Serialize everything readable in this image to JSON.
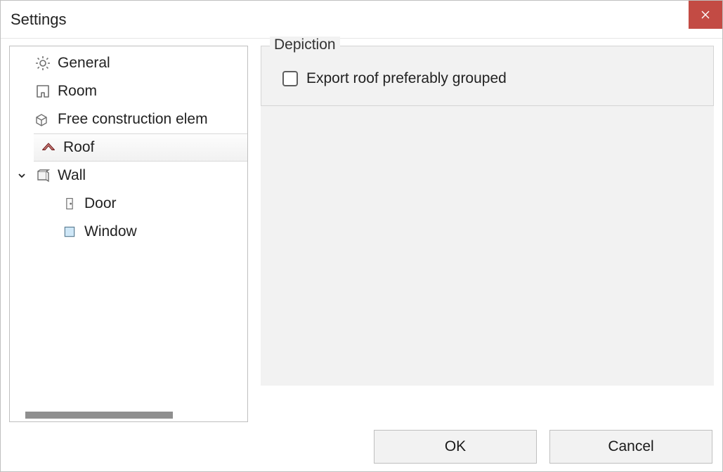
{
  "window": {
    "title": "Settings"
  },
  "tree": {
    "items": [
      {
        "icon": "gear-icon",
        "label": "General",
        "level": 0,
        "expander": "blank"
      },
      {
        "icon": "room-icon",
        "label": "Room",
        "level": 0,
        "expander": "blank"
      },
      {
        "icon": "box3d-icon",
        "label": "Free construction elem",
        "level": 0,
        "expander": "blank"
      },
      {
        "icon": "roof-icon",
        "label": "Roof",
        "level": 0,
        "expander": "blank",
        "selected": true
      },
      {
        "icon": "wall-icon",
        "label": "Wall",
        "level": 0,
        "expander": "down"
      },
      {
        "icon": "door-icon",
        "label": "Door",
        "level": 2,
        "expander": "none"
      },
      {
        "icon": "window-icon",
        "label": "Window",
        "level": 2,
        "expander": "none"
      }
    ]
  },
  "panel": {
    "group_title": "Depiction",
    "checkbox_label": "Export roof preferably grouped",
    "checkbox_checked": false
  },
  "footer": {
    "ok": "OK",
    "cancel": "Cancel"
  }
}
